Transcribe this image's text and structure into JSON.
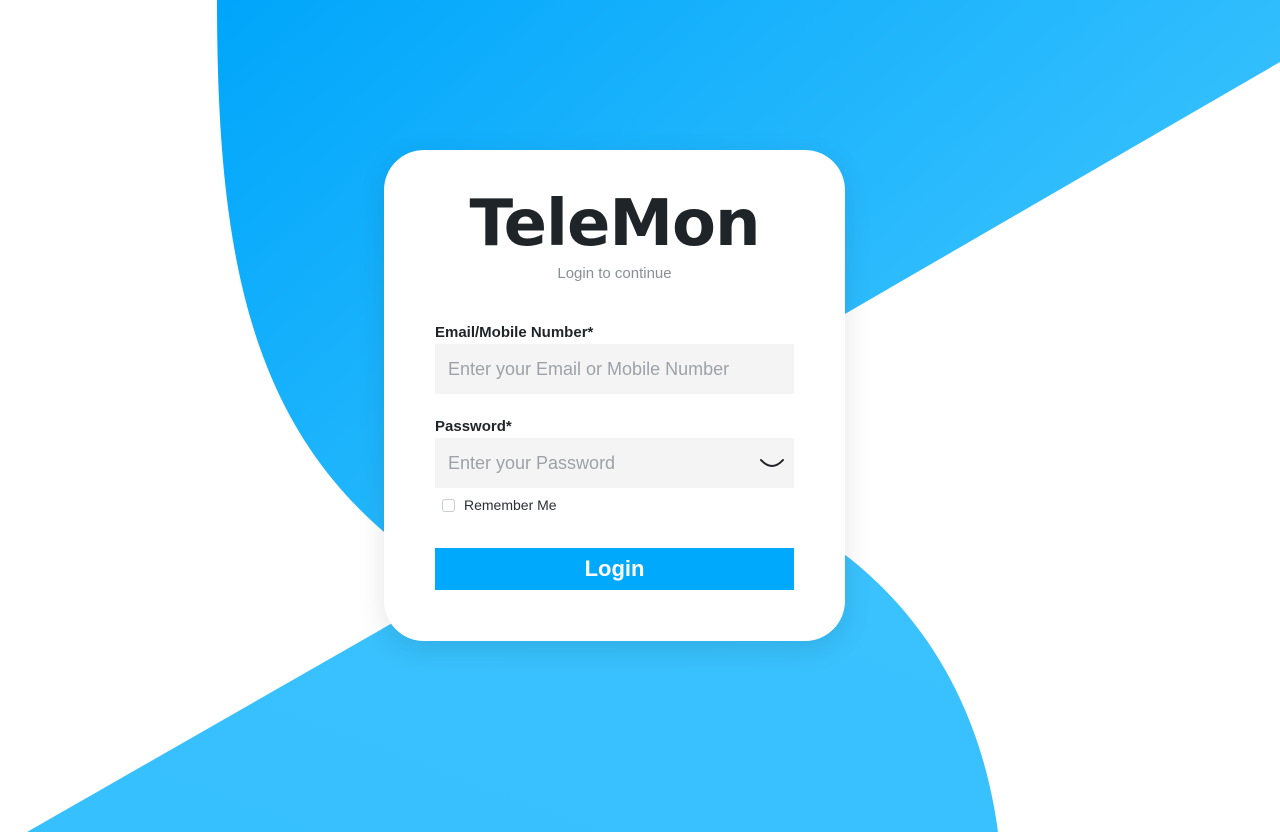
{
  "app": {
    "brand_name": "TeleMon",
    "subtitle": "Login to continue"
  },
  "form": {
    "email": {
      "label": "Email/Mobile Number*",
      "placeholder": "Enter your Email or Mobile Number",
      "value": ""
    },
    "password": {
      "label": "Password*",
      "placeholder": "Enter your Password",
      "value": "",
      "toggle_icon": "eye-closed-icon"
    },
    "remember_me": {
      "label": "Remember Me",
      "checked": false
    },
    "submit_label": "Login"
  },
  "colors": {
    "accent": "#00a9fb",
    "accent_light": "#38c2fd",
    "text_dark": "#1f2429",
    "text_muted": "#8a8f95",
    "input_bg": "#f4f4f5"
  }
}
